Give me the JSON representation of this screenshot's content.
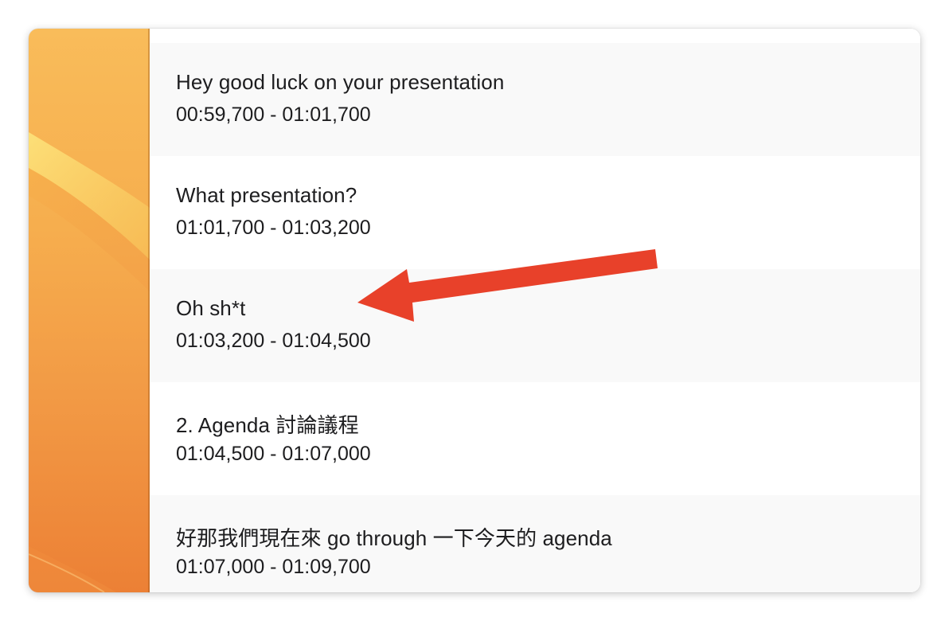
{
  "subtitles": [
    {
      "text": "Hey good luck on your presentation",
      "time": "00:59,700 - 01:01,700"
    },
    {
      "text": "What presentation?",
      "time": "01:01,700 - 01:03,200"
    },
    {
      "text": "Oh sh*t",
      "time": "01:03,200 - 01:04,500"
    },
    {
      "text": "2. Agenda 討論議程",
      "time": "01:04,500 - 01:07,000"
    },
    {
      "text": "好那我們現在來 go through 一下今天的 agenda",
      "time": "01:07,000 - 01:09,700"
    }
  ],
  "annotation": {
    "icon": "red-arrow-icon",
    "color": "#e8412a",
    "points_to": "Oh sh*t"
  }
}
